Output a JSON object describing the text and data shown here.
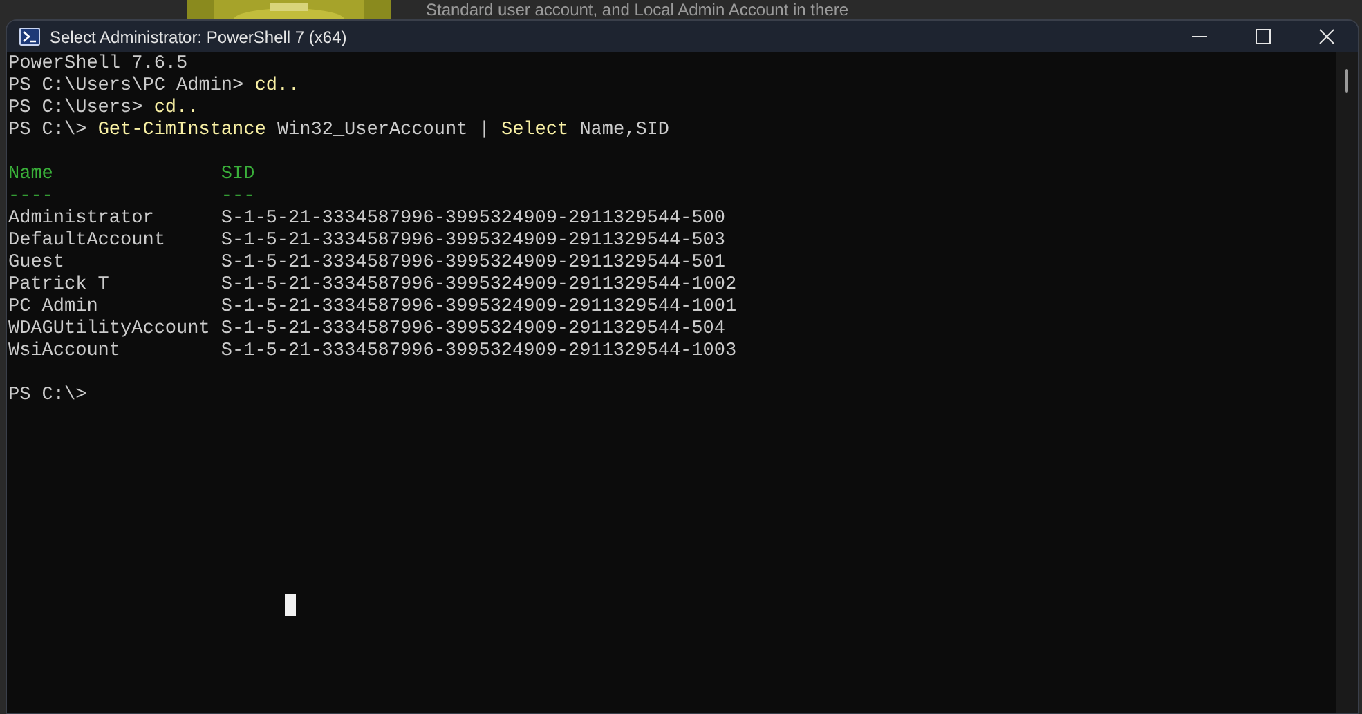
{
  "background": {
    "caption": "Standard user account, and Local Admin Account in there"
  },
  "window": {
    "title": "Select Administrator: PowerShell 7 (x64)"
  },
  "terminal": {
    "lines": [
      {
        "segments": [
          {
            "kind": "text",
            "text": "PowerShell 7.6.5"
          }
        ]
      },
      {
        "segments": [
          {
            "kind": "text",
            "text": "PS C:\\Users\\PC Admin> "
          },
          {
            "kind": "command",
            "text": "cd.."
          }
        ]
      },
      {
        "segments": [
          {
            "kind": "text",
            "text": "PS C:\\Users> "
          },
          {
            "kind": "command",
            "text": "cd.."
          }
        ]
      },
      {
        "segments": [
          {
            "kind": "text",
            "text": "PS C:\\> "
          },
          {
            "kind": "command",
            "text": "Get-CimInstance"
          },
          {
            "kind": "text",
            "text": " Win32_UserAccount | "
          },
          {
            "kind": "command",
            "text": "Select"
          },
          {
            "kind": "text",
            "text": " Name,SID"
          }
        ]
      }
    ],
    "table": {
      "columns": [
        {
          "header": "Name",
          "underline": "----"
        },
        {
          "header": "SID",
          "underline": "---"
        }
      ],
      "rows": [
        [
          "Administrator",
          "S-1-5-21-3334587996-3995324909-2911329544-500"
        ],
        [
          "DefaultAccount",
          "S-1-5-21-3334587996-3995324909-2911329544-503"
        ],
        [
          "Guest",
          "S-1-5-21-3334587996-3995324909-2911329544-501"
        ],
        [
          "Patrick T",
          "S-1-5-21-3334587996-3995324909-2911329544-1002"
        ],
        [
          "PC Admin",
          "S-1-5-21-3334587996-3995324909-2911329544-1001"
        ],
        [
          "WDAGUtilityAccount",
          "S-1-5-21-3334587996-3995324909-2911329544-504"
        ],
        [
          "WsiAccount",
          "S-1-5-21-3334587996-3995324909-2911329544-1003"
        ]
      ]
    },
    "prompt": "PS C:\\>"
  }
}
